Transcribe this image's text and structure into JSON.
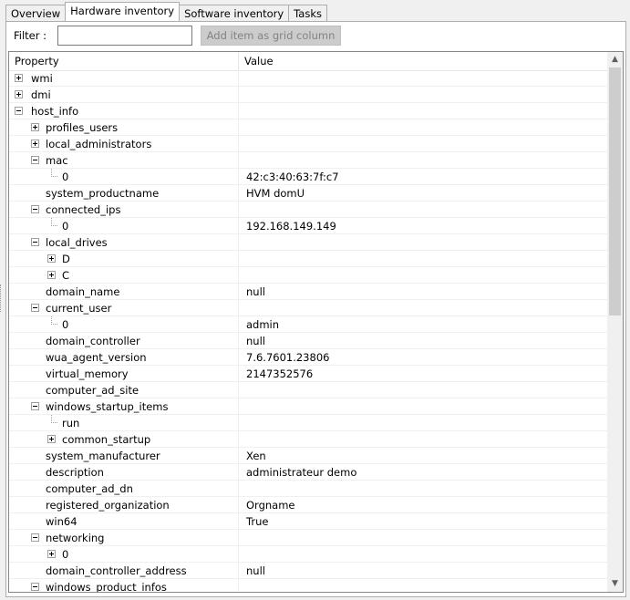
{
  "tabs": [
    {
      "label": "Overview",
      "active": false
    },
    {
      "label": "Hardware inventory",
      "active": true
    },
    {
      "label": "Software inventory",
      "active": false
    },
    {
      "label": "Tasks",
      "active": false
    }
  ],
  "filter": {
    "label": "Filter :",
    "value": ""
  },
  "add_button": {
    "label": "Add item as grid column"
  },
  "grid": {
    "columns": {
      "property": "Property",
      "value": "Value"
    },
    "rows": [
      {
        "name": "wmi",
        "value": "",
        "level": 0,
        "node": "collapsed"
      },
      {
        "name": "dmi",
        "value": "",
        "level": 0,
        "node": "collapsed"
      },
      {
        "name": "host_info",
        "value": "",
        "level": 0,
        "node": "expanded"
      },
      {
        "name": "profiles_users",
        "value": "",
        "level": 1,
        "node": "collapsed"
      },
      {
        "name": "local_administrators",
        "value": "",
        "level": 1,
        "node": "collapsed"
      },
      {
        "name": "mac",
        "value": "",
        "level": 1,
        "node": "expanded"
      },
      {
        "name": "0",
        "value": "42:c3:40:63:7f:c7",
        "level": 2,
        "node": "leaf"
      },
      {
        "name": "system_productname",
        "value": "HVM domU",
        "level": 1,
        "node": "none"
      },
      {
        "name": "connected_ips",
        "value": "",
        "level": 1,
        "node": "expanded"
      },
      {
        "name": "0",
        "value": "192.168.149.149",
        "level": 2,
        "node": "leaf"
      },
      {
        "name": "local_drives",
        "value": "",
        "level": 1,
        "node": "expanded"
      },
      {
        "name": "D",
        "value": "",
        "level": 2,
        "node": "collapsed"
      },
      {
        "name": "C",
        "value": "",
        "level": 2,
        "node": "collapsed"
      },
      {
        "name": "domain_name",
        "value": "null",
        "level": 1,
        "node": "none"
      },
      {
        "name": "current_user",
        "value": "",
        "level": 1,
        "node": "expanded"
      },
      {
        "name": "0",
        "value": "admin",
        "level": 2,
        "node": "leaf"
      },
      {
        "name": "domain_controller",
        "value": "null",
        "level": 1,
        "node": "none"
      },
      {
        "name": "wua_agent_version",
        "value": "7.6.7601.23806",
        "level": 1,
        "node": "none"
      },
      {
        "name": "virtual_memory",
        "value": "2147352576",
        "level": 1,
        "node": "none"
      },
      {
        "name": "computer_ad_site",
        "value": "",
        "level": 1,
        "node": "none"
      },
      {
        "name": "windows_startup_items",
        "value": "",
        "level": 1,
        "node": "expanded"
      },
      {
        "name": "run",
        "value": "",
        "level": 2,
        "node": "leaf"
      },
      {
        "name": "common_startup",
        "value": "",
        "level": 2,
        "node": "collapsed"
      },
      {
        "name": "system_manufacturer",
        "value": "Xen",
        "level": 1,
        "node": "none"
      },
      {
        "name": "description",
        "value": "administrateur demo",
        "level": 1,
        "node": "none"
      },
      {
        "name": "computer_ad_dn",
        "value": "",
        "level": 1,
        "node": "none"
      },
      {
        "name": "registered_organization",
        "value": "Orgname",
        "level": 1,
        "node": "none"
      },
      {
        "name": "win64",
        "value": "True",
        "level": 1,
        "node": "none"
      },
      {
        "name": "networking",
        "value": "",
        "level": 1,
        "node": "expanded"
      },
      {
        "name": "0",
        "value": "",
        "level": 2,
        "node": "collapsed"
      },
      {
        "name": "domain_controller_address",
        "value": "null",
        "level": 1,
        "node": "none"
      },
      {
        "name": "windows_product_infos",
        "value": "",
        "level": 1,
        "node": "expanded"
      }
    ]
  },
  "scrollbar": {
    "up_icon": "scroll-up-arrow-icon",
    "down_icon": "scroll-down-arrow-icon"
  }
}
